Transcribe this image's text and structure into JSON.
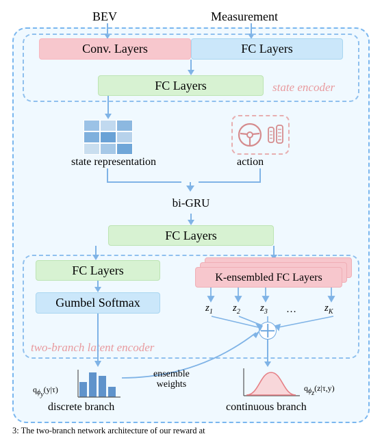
{
  "inputs": {
    "bev": "BEV",
    "measurement": "Measurement"
  },
  "encoder": {
    "conv": "Conv. Layers",
    "fcq_top": "FC Layers",
    "fc_mid": "FC Layers",
    "label": "state encoder"
  },
  "state_repr": "state representation",
  "action": "action",
  "bigru": "bi-GRU",
  "fc_below_gru": "FC Layers",
  "branch": {
    "fc_left": "FC Layers",
    "softmax": "Gumbel Softmax",
    "ensembled": "K-ensembled FC Layers",
    "label": "two-branch latent encoder",
    "z": [
      "z",
      "z",
      "z",
      "…",
      "z"
    ],
    "z_sub": [
      "1",
      "2",
      "3",
      "",
      "K"
    ]
  },
  "outputs": {
    "discrete": "discrete branch",
    "continuous": "continuous branch",
    "ensemble_weights_l1": "ensemble",
    "ensemble_weights_l2": "weights",
    "q_y": "q",
    "q_y_sub": "ϕ",
    "q_y_tail": "(y|τ)",
    "q_z": "q",
    "q_z_sub": "ϕ",
    "q_z_tail": "(z|τ,y)"
  },
  "caption": "3: The two-branch network architecture of our reward at"
}
